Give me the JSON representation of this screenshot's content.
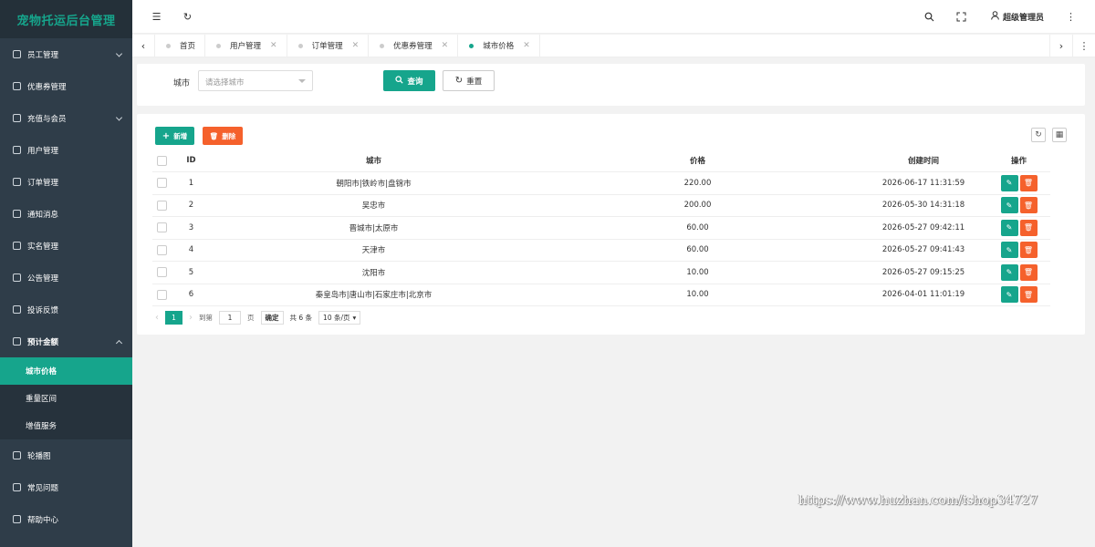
{
  "app_title": "宠物托运后台管理",
  "sidebar": {
    "items": [
      {
        "label": "员工管理",
        "icon": "user-icon",
        "has_arrow": true
      },
      {
        "label": "优惠券管理",
        "icon": "coupon-icon",
        "has_arrow": false
      },
      {
        "label": "充值与会员",
        "icon": "card-icon",
        "has_arrow": true
      },
      {
        "label": "用户管理",
        "icon": "users-icon",
        "has_arrow": false
      },
      {
        "label": "订单管理",
        "icon": "order-icon",
        "has_arrow": false
      },
      {
        "label": "通知消息",
        "icon": "notice-icon",
        "has_arrow": false
      },
      {
        "label": "实名管理",
        "icon": "id-card-icon",
        "has_arrow": false
      },
      {
        "label": "公告管理",
        "icon": "announce-icon",
        "has_arrow": false
      },
      {
        "label": "投诉反馈",
        "icon": "feedback-icon",
        "has_arrow": false
      },
      {
        "label": "预计金额",
        "icon": "money-icon",
        "has_arrow": true,
        "expanded": true
      },
      {
        "label": "轮播图",
        "icon": "carousel-icon",
        "has_arrow": false
      },
      {
        "label": "常见问题",
        "icon": "question-icon",
        "has_arrow": false
      },
      {
        "label": "帮助中心",
        "icon": "help-icon",
        "has_arrow": false
      }
    ],
    "sub_items": [
      {
        "label": "城市价格",
        "active": true
      },
      {
        "label": "重量区间",
        "active": false
      },
      {
        "label": "增值服务",
        "active": false
      }
    ]
  },
  "header": {
    "admin_name": "超级管理员"
  },
  "tabs": [
    {
      "label": "首页",
      "closable": false,
      "active": false
    },
    {
      "label": "用户管理",
      "closable": true,
      "active": false
    },
    {
      "label": "订单管理",
      "closable": true,
      "active": false
    },
    {
      "label": "优惠券管理",
      "closable": true,
      "active": false
    },
    {
      "label": "城市价格",
      "closable": true,
      "active": true
    }
  ],
  "search": {
    "city_label": "城市",
    "city_placeholder": "请选择城市",
    "query_label": "查询",
    "reset_label": "重置"
  },
  "toolbar": {
    "add_label": "新增",
    "delete_label": "删除"
  },
  "table": {
    "columns": [
      "ID",
      "城市",
      "价格",
      "创建时间",
      "操作"
    ],
    "rows": [
      {
        "id": "1",
        "city": "朝阳市|铁岭市|盘锦市",
        "price": "220.00",
        "created": "2026-06-17 11:31:59"
      },
      {
        "id": "2",
        "city": "吴忠市",
        "price": "200.00",
        "created": "2026-05-30 14:31:18"
      },
      {
        "id": "3",
        "city": "晋城市|太原市",
        "price": "60.00",
        "created": "2026-05-27 09:42:11"
      },
      {
        "id": "4",
        "city": "天津市",
        "price": "60.00",
        "created": "2026-05-27 09:41:43"
      },
      {
        "id": "5",
        "city": "沈阳市",
        "price": "10.00",
        "created": "2026-05-27 09:15:25"
      },
      {
        "id": "6",
        "city": "秦皇岛市|唐山市|石家庄市|北京市",
        "price": "10.00",
        "created": "2026-04-01 11:01:19"
      }
    ]
  },
  "pager": {
    "current": "1",
    "goto_label": "到第",
    "goto_value": "1",
    "page_unit": "页",
    "confirm": "确定",
    "total": "共 6 条",
    "per_page": "10 条/页"
  },
  "watermark": "https://www.huzhan.com/ishop34727",
  "colors": {
    "accent": "#16a58c",
    "danger": "#f5612c",
    "sidebar": "#2f3d49"
  }
}
